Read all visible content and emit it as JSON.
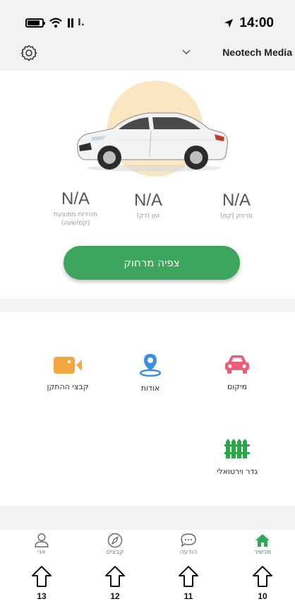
{
  "status_bar": {
    "time": "14:00",
    "carrier": "I.",
    "icons": [
      "battery-icon",
      "wifi-icon",
      "signal-icon",
      "location-arrow-icon"
    ]
  },
  "header": {
    "device_name": "Neotech Media",
    "icons": [
      "gear-icon",
      "chevron-down-icon"
    ]
  },
  "stats": [
    {
      "value": "N/A",
      "label": "מרחק (קמ)"
    },
    {
      "value": "N/A",
      "label": "זמן (דק)"
    },
    {
      "value": "N/A",
      "label_line1": "מהירות ממוצעת",
      "label_line2": "(קמ/שעה)"
    }
  ],
  "remote_button": {
    "label": "צפיה מרחוק"
  },
  "grid": [
    {
      "label": "מיקום",
      "icon": "car-icon",
      "color": "#ef5b7b"
    },
    {
      "label": "אודות",
      "icon": "location-pin-icon",
      "color": "#3b8fe0"
    },
    {
      "label": "קבצי ההתקן",
      "icon": "video-camera-icon",
      "color": "#f6a640"
    },
    {
      "label": "גדר וירטואלי",
      "icon": "fence-icon",
      "color": "#28a745"
    }
  ],
  "tabs": [
    {
      "label": "מכשיר",
      "icon": "home-icon",
      "active": true
    },
    {
      "label": "הודעה",
      "icon": "chat-bubble-icon",
      "active": false
    },
    {
      "label": "קבצים",
      "icon": "compass-icon",
      "active": false
    },
    {
      "label": "אני",
      "icon": "user-icon",
      "active": false
    }
  ],
  "annotations": [
    "10",
    "11",
    "12",
    "13"
  ],
  "colors": {
    "accent": "#3da65e",
    "active_tab": "#2eab5a",
    "band": "#f2f2f2",
    "car_circle": "#fbe6c2"
  }
}
